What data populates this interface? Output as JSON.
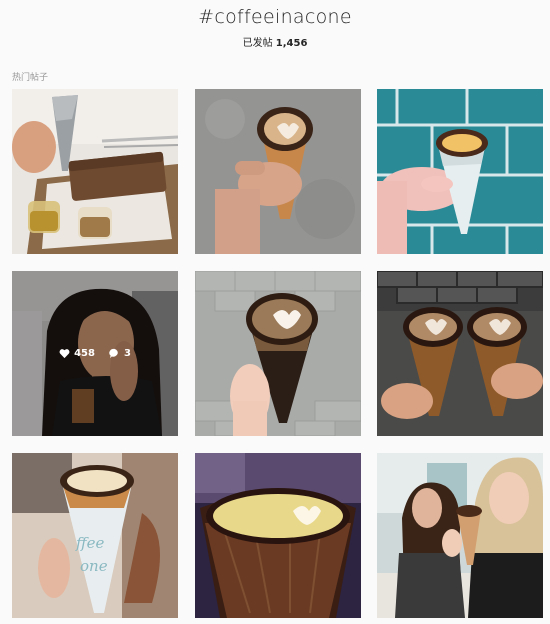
{
  "header": {
    "hashtag": "#coffeeinacone",
    "posts_label": "已发帖",
    "posts_count": "1,456"
  },
  "section": {
    "label": "热门帖子"
  },
  "posts": [
    {
      "name": "post-coffee-cone-banana-bread",
      "icon": "image"
    },
    {
      "name": "post-hand-holding-cone-concrete",
      "icon": "image"
    },
    {
      "name": "post-cone-blue-tiles",
      "icon": "image"
    },
    {
      "name": "post-woman-selfie-cone",
      "icon": "image",
      "likes": "458",
      "comments": "3"
    },
    {
      "name": "post-cone-heart-latte-pavement",
      "icon": "image"
    },
    {
      "name": "post-two-cones-brick-wall",
      "icon": "image"
    },
    {
      "name": "post-coffee-in-a-cone-paper",
      "icon": "image"
    },
    {
      "name": "post-closeup-cone-latte",
      "icon": "image"
    },
    {
      "name": "post-two-women-with-cones",
      "icon": "image"
    }
  ],
  "colors": {
    "background": "#fafafa",
    "text": "#262626",
    "muted": "#999999",
    "overlay": "rgba(0,0,0,0.3)"
  }
}
